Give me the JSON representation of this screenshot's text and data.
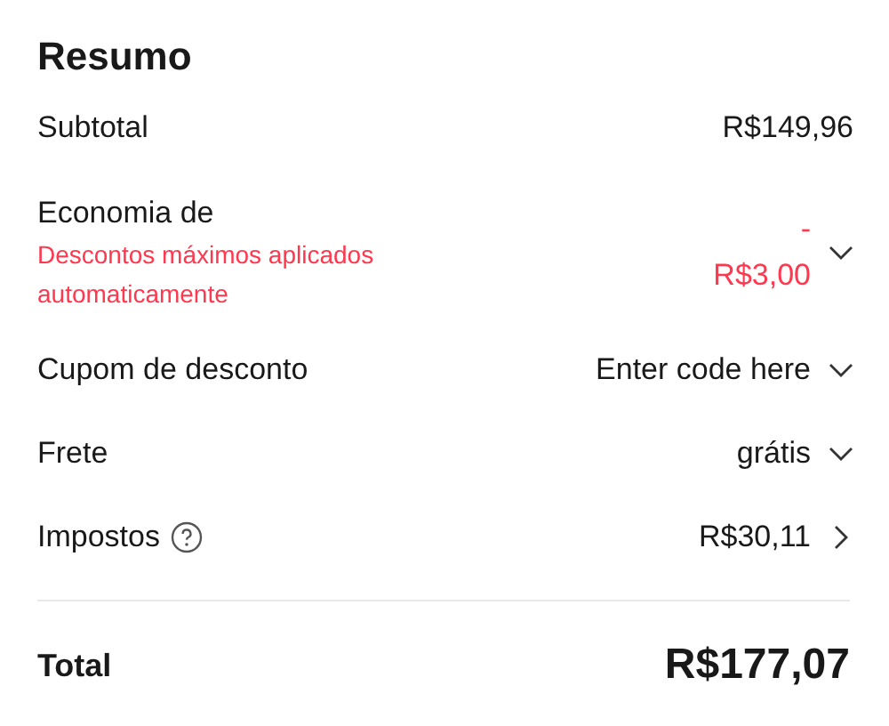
{
  "title": "Resumo",
  "rows": [
    {
      "kind": "plain",
      "label": "Subtotal",
      "value": "R$149,96"
    },
    {
      "kind": "savings",
      "label": "Economia de",
      "note": "Descontos máximos aplicados automaticamente",
      "value": "- R$3,00",
      "expandable": true
    },
    {
      "kind": "plain",
      "label": "Cupom de desconto",
      "value": "Enter code here",
      "expandable": true
    },
    {
      "kind": "plain",
      "label": "Frete",
      "value": "grátis",
      "expandable": true
    },
    {
      "kind": "help",
      "label": "Impostos",
      "value": "R$30,11",
      "expandable": false
    }
  ],
  "total": {
    "label": "Total",
    "value": "R$177,07"
  }
}
